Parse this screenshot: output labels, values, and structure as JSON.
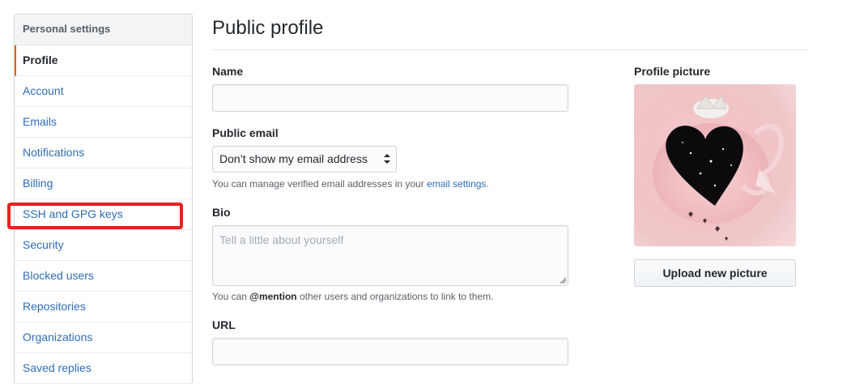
{
  "sidebar": {
    "header": "Personal settings",
    "items": [
      {
        "label": "Profile"
      },
      {
        "label": "Account"
      },
      {
        "label": "Emails"
      },
      {
        "label": "Notifications"
      },
      {
        "label": "Billing"
      },
      {
        "label": "SSH and GPG keys"
      },
      {
        "label": "Security"
      },
      {
        "label": "Blocked users"
      },
      {
        "label": "Repositories"
      },
      {
        "label": "Organizations"
      },
      {
        "label": "Saved replies"
      }
    ],
    "selected": "Profile",
    "highlighted": "SSH and GPG keys"
  },
  "main": {
    "title": "Public profile",
    "name": {
      "label": "Name",
      "value": ""
    },
    "public_email": {
      "label": "Public email",
      "selected": "Don’t show my email address",
      "note_before": "You can manage verified email addresses in your ",
      "note_link": "email settings",
      "note_after": "."
    },
    "bio": {
      "label": "Bio",
      "placeholder": "Tell a little about yourself",
      "note_before": "You can ",
      "note_strong": "@mention",
      "note_after": " other users and organizations to link to them."
    },
    "url": {
      "label": "URL",
      "value": ""
    }
  },
  "profile_picture": {
    "label": "Profile picture",
    "upload_label": "Upload new picture"
  },
  "colors": {
    "accent_link": "#2f6db5",
    "selected_marker": "#e36209",
    "highlight": "#e22222"
  }
}
